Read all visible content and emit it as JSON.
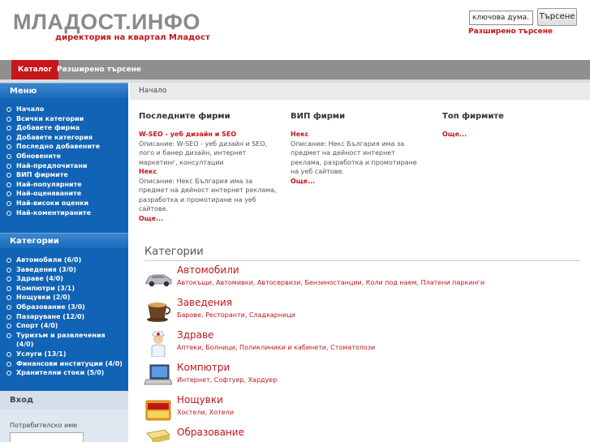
{
  "header": {
    "site_title": "МЛАДОСТ.ИНФО",
    "tagline": "директория на квартал Младост",
    "search_value": "ключова дума...",
    "search_button": "Търсене",
    "advanced_search": "Разширено търсене"
  },
  "tabs": [
    {
      "label": "Каталог",
      "active": true
    },
    {
      "label": "Разширено търсене",
      "active": false
    }
  ],
  "sidebar": {
    "menu_title": "Меню",
    "menu_items": [
      "Начало",
      "Всички категории",
      "Добавете фирма",
      "Добавете категория",
      "Последно добавените",
      "Обновените",
      "Най-предпочитани",
      "ВИП фирмите",
      "Най-популярните",
      "Най-оценяваните",
      "Най-високи оценки",
      "Най-коментираните"
    ],
    "categories_title": "Категории",
    "category_items": [
      "Автомобили (6/0)",
      "Заведения (3/0)",
      "Здраве (4/0)",
      "Компютри (3/1)",
      "Нощувки (2/0)",
      "Образование (3/0)",
      "Пазаруване (12/0)",
      "Спорт (4/0)",
      "Туризъм и развлечения",
      "(4/0)",
      "Услуги (13/1)",
      "Финансови институции (4/0)",
      "Хранителни стоки (5/0)"
    ],
    "login_title": "Вход",
    "login_user_label": "Потребителско име"
  },
  "main": {
    "breadcrumb": "Начало",
    "latest": {
      "title": "Последните фирми",
      "firms": [
        {
          "name": "W-SEO - уеб дизайн и SEO",
          "desc": "Описание: W-SEO - уеб дизайн и SEO, лого и банер дизайн, интернет маркетинг, консултации"
        },
        {
          "name": "Некс",
          "desc": "Описание: Некс България има за предмет на дейност интернет реклама, разработка и промотиране на уеб сайтове."
        }
      ],
      "more": "Още..."
    },
    "vip": {
      "title": "ВИП фирми",
      "firms": [
        {
          "name": "Некс",
          "desc": "Описание: Некс България има за предмет на дейност интернет реклама, разработка и промотиране на уеб сайтове."
        }
      ],
      "more": "Още..."
    },
    "top": {
      "title": "Топ фирмите",
      "more": "Още..."
    },
    "categories_title": "Категории",
    "categories": [
      {
        "name": "Автомобили",
        "sub": "Автокъщи, Автомивки, Автосервизи, Бензиностанции, Коли под наем, Платени паркинги",
        "icon": "car-icon"
      },
      {
        "name": "Заведения",
        "sub": "Барове, Ресторанти, Сладкарници",
        "icon": "coffee-icon"
      },
      {
        "name": "Здраве",
        "sub": "Аптеки, Болници, Поликлиники и кабинети, Стоматолози",
        "icon": "nurse-icon"
      },
      {
        "name": "Компютри",
        "sub": "Интернет, Софтуер, Хардуер",
        "icon": "laptop-icon"
      },
      {
        "name": "Нощувки",
        "sub": "Хостели, Хотели",
        "icon": "bed-icon"
      },
      {
        "name": "Образование",
        "sub": "",
        "icon": "book-icon"
      }
    ]
  },
  "colors": {
    "accent_red": "#c0161a",
    "sidebar_blue": "#1163b6",
    "tabbar_gray": "#8f8f8f"
  }
}
